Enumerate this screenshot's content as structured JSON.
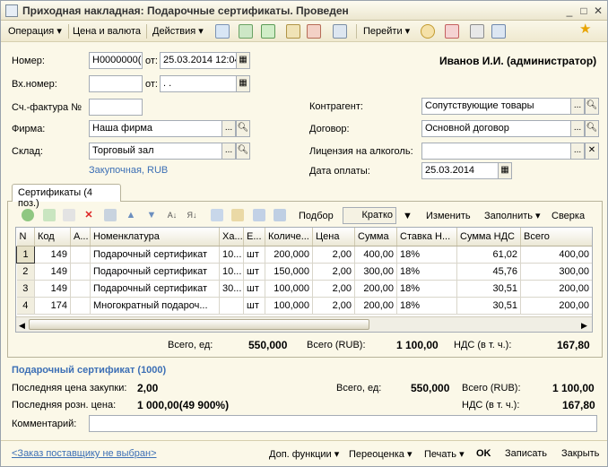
{
  "window": {
    "title": "Приходная накладная: Подарочные сертификаты. Проведен",
    "min": "_",
    "max": "□",
    "close": "✕"
  },
  "toolbar": {
    "operation": "Операция ▾",
    "price_currency": "Цена и валюта",
    "actions": "Действия ▾",
    "goto": "Перейти ▾"
  },
  "header": {
    "number_label": "Номер:",
    "number_value": "Н0000000(",
    "from_label": "от:",
    "date_value": "25.03.2014 12:04",
    "user": "Иванов И.И. (администратор)",
    "in_number_label": "Вх.номер:",
    "in_from_label": "от:",
    "in_date_value": " .  .",
    "invoice_label": "Сч.-фактура №",
    "firm_label": "Фирма:",
    "firm_value": "Наша фирма",
    "warehouse_label": "Склад:",
    "warehouse_value": "Торговый зал",
    "price_link": "Закупочная, RUB",
    "contractor_label": "Контрагент:",
    "contractor_value": "Сопутствующие товары",
    "contract_label": "Договор:",
    "contract_value": "Основной договор",
    "license_label": "Лицензия на алкоголь:",
    "license_value": "",
    "pay_date_label": "Дата оплаты:",
    "pay_date_value": "25.03.2014"
  },
  "tab": {
    "label": "Сертификаты (4 поз.)"
  },
  "grid_toolbar": {
    "select": "Подбор",
    "mode": "Кратко",
    "change": "Изменить",
    "fill": "Заполнить ▾",
    "check": "Сверка"
  },
  "table": {
    "columns": [
      "N",
      "Код",
      "А...",
      "Номенклатура",
      "Ха...",
      "Е...",
      "Количе...",
      "Цена",
      "Сумма",
      "Ставка Н...",
      "Сумма НДС",
      "Всего"
    ],
    "rows": [
      [
        "1",
        "149",
        "",
        "Подарочный сертификат",
        "10...",
        "шт",
        "200,000",
        "2,00",
        "400,00",
        "18%",
        "61,02",
        "400,00"
      ],
      [
        "2",
        "149",
        "",
        "Подарочный сертификат",
        "10...",
        "шт",
        "150,000",
        "2,00",
        "300,00",
        "18%",
        "45,76",
        "300,00"
      ],
      [
        "3",
        "149",
        "",
        "Подарочный сертификат",
        "30...",
        "шт",
        "100,000",
        "2,00",
        "200,00",
        "18%",
        "30,51",
        "200,00"
      ],
      [
        "4",
        "174",
        "",
        "Многократный подароч...",
        "",
        "шт",
        "100,000",
        "2,00",
        "200,00",
        "18%",
        "30,51",
        "200,00"
      ]
    ]
  },
  "totals": {
    "count_label": "Всего, ед:",
    "count_value": "550,000",
    "sum_label": "Всего (RUB):",
    "sum_value": "1 100,00",
    "vat_label": "НДС (в т. ч.):",
    "vat_value": "167,80"
  },
  "details": {
    "item_title": "Подарочный сертификат (1000)",
    "last_purchase_label": "Последняя цена закупки:",
    "last_purchase_value": "2,00",
    "last_retail_label": "Последняя розн. цена:",
    "last_retail_value": "1 000,00(49 900%)",
    "count_label": "Всего, ед:",
    "count_value": "550,000",
    "sum_label": "Всего (RUB):",
    "sum_value": "1 100,00",
    "vat_label": "НДС (в т. ч.):",
    "vat_value": "167,80",
    "comment_label": "Комментарий:",
    "comment_value": ""
  },
  "bottom": {
    "order_link": "<Заказ поставщику не выбран>",
    "extra": "Доп. функции ▾",
    "reprice": "Переоценка ▾",
    "print": "Печать ▾",
    "ok": "OK",
    "save": "Записать",
    "close": "Закрыть"
  }
}
